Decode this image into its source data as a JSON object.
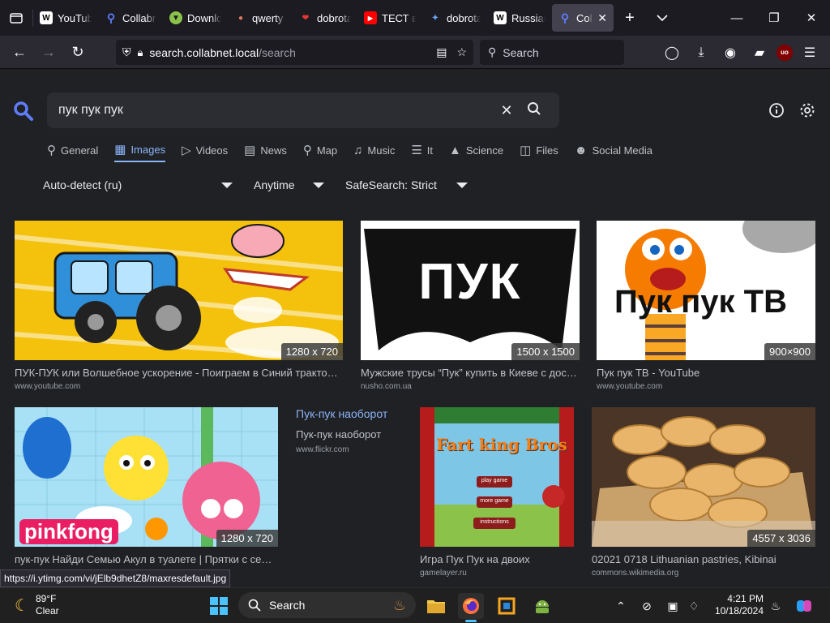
{
  "tabs": [
    {
      "label": "YouTube",
      "icon": "youtube-icon"
    },
    {
      "label": "Collabnet",
      "icon": "search-icon"
    },
    {
      "label": "Downloads",
      "icon": "download-icon"
    },
    {
      "label": "qwerty",
      "icon": "mask-icon"
    },
    {
      "label": "dobrota",
      "icon": "heart-icon"
    },
    {
      "label": "ТЕСТ в",
      "icon": "youtube-icon"
    },
    {
      "label": "dobrota",
      "icon": "bird-icon"
    },
    {
      "label": "Russian",
      "icon": "wikipedia-icon"
    },
    {
      "label": "Collabnet",
      "icon": "search-icon",
      "active": true
    }
  ],
  "browser": {
    "url_host": "search.collabnet.local",
    "url_path": "/search",
    "search_placeholder": "Search"
  },
  "search": {
    "query": "пук пук пук"
  },
  "categories": [
    {
      "label": "General",
      "icon": "search-icon"
    },
    {
      "label": "Images",
      "icon": "image-icon",
      "active": true
    },
    {
      "label": "Videos",
      "icon": "play-icon"
    },
    {
      "label": "News",
      "icon": "newspaper-icon"
    },
    {
      "label": "Map",
      "icon": "map-pin-icon"
    },
    {
      "label": "Music",
      "icon": "music-icon"
    },
    {
      "label": "It",
      "icon": "layers-icon"
    },
    {
      "label": "Science",
      "icon": "graduation-cap-icon"
    },
    {
      "label": "Files",
      "icon": "files-icon"
    },
    {
      "label": "Social Media",
      "icon": "users-icon"
    }
  ],
  "filters": {
    "language": "Auto-detect (ru)",
    "time": "Anytime",
    "safesearch": "SafeSearch: Strict"
  },
  "results": [
    {
      "title": "ПУК-ПУК или Волшебное ускорение - Поиграем в Синий трактор - Мультфильм",
      "source": "www.youtube.com",
      "dims": "1280 x 720"
    },
    {
      "title": "Мужские трусы “Пук” купить в Киеве с доставкой",
      "source": "nusho.com.ua",
      "dims": "1500 x 1500",
      "image_text": "ПУК"
    },
    {
      "title": "Пук пук ТВ - YouTube",
      "source": "www.youtube.com",
      "dims": "900×900",
      "image_text": "Пук пук ТВ"
    },
    {
      "title": "пук-пук Найди Семью Акул в туалете | Прятки с семьёй",
      "source": "",
      "dims": "1280 x 720",
      "image_text": "pinkfong"
    },
    {
      "title": "Пук-пук наоборот",
      "subtitle": "Пук-пук наоборот",
      "source": "www.flickr.com"
    },
    {
      "title": "Игра Пук Пук на двоих",
      "source": "gamelayer.ru",
      "image_text": "Fart king Bros",
      "menu": [
        "play game",
        "more game",
        "instructions"
      ]
    },
    {
      "title": "02021 0718 Lithuanian pastries, Kibinai",
      "source": "commons.wikimedia.org",
      "dims": "4557 x 3036"
    }
  ],
  "status_url": "https://i.ytimg.com/vi/jElb9dhetZ8/maxresdefault.jpg",
  "taskbar": {
    "weather_temp": "89°F",
    "weather_desc": "Clear",
    "search_label": "Search",
    "time": "4:21 PM",
    "date": "10/18/2024",
    "ublock_label": "uo"
  },
  "colors": {
    "accent": "#8ab4f8",
    "logo": "#5e7dfb",
    "page_bg": "#202124"
  }
}
